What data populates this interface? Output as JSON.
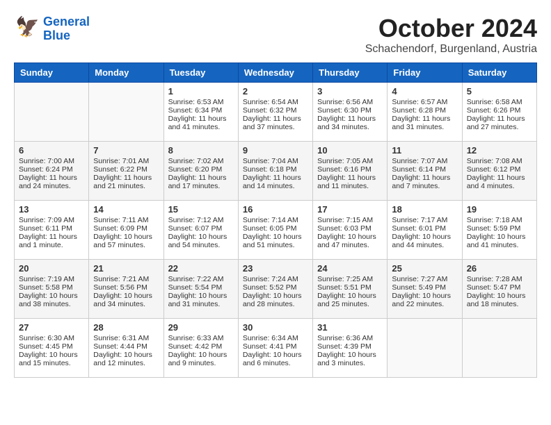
{
  "header": {
    "logo_line1": "General",
    "logo_line2": "Blue",
    "month": "October 2024",
    "location": "Schachendorf, Burgenland, Austria"
  },
  "days_of_week": [
    "Sunday",
    "Monday",
    "Tuesday",
    "Wednesday",
    "Thursday",
    "Friday",
    "Saturday"
  ],
  "weeks": [
    [
      {
        "day": "",
        "info": ""
      },
      {
        "day": "",
        "info": ""
      },
      {
        "day": "1",
        "info": "Sunrise: 6:53 AM\nSunset: 6:34 PM\nDaylight: 11 hours\nand 41 minutes."
      },
      {
        "day": "2",
        "info": "Sunrise: 6:54 AM\nSunset: 6:32 PM\nDaylight: 11 hours\nand 37 minutes."
      },
      {
        "day": "3",
        "info": "Sunrise: 6:56 AM\nSunset: 6:30 PM\nDaylight: 11 hours\nand 34 minutes."
      },
      {
        "day": "4",
        "info": "Sunrise: 6:57 AM\nSunset: 6:28 PM\nDaylight: 11 hours\nand 31 minutes."
      },
      {
        "day": "5",
        "info": "Sunrise: 6:58 AM\nSunset: 6:26 PM\nDaylight: 11 hours\nand 27 minutes."
      }
    ],
    [
      {
        "day": "6",
        "info": "Sunrise: 7:00 AM\nSunset: 6:24 PM\nDaylight: 11 hours\nand 24 minutes."
      },
      {
        "day": "7",
        "info": "Sunrise: 7:01 AM\nSunset: 6:22 PM\nDaylight: 11 hours\nand 21 minutes."
      },
      {
        "day": "8",
        "info": "Sunrise: 7:02 AM\nSunset: 6:20 PM\nDaylight: 11 hours\nand 17 minutes."
      },
      {
        "day": "9",
        "info": "Sunrise: 7:04 AM\nSunset: 6:18 PM\nDaylight: 11 hours\nand 14 minutes."
      },
      {
        "day": "10",
        "info": "Sunrise: 7:05 AM\nSunset: 6:16 PM\nDaylight: 11 hours\nand 11 minutes."
      },
      {
        "day": "11",
        "info": "Sunrise: 7:07 AM\nSunset: 6:14 PM\nDaylight: 11 hours\nand 7 minutes."
      },
      {
        "day": "12",
        "info": "Sunrise: 7:08 AM\nSunset: 6:12 PM\nDaylight: 11 hours\nand 4 minutes."
      }
    ],
    [
      {
        "day": "13",
        "info": "Sunrise: 7:09 AM\nSunset: 6:11 PM\nDaylight: 11 hours\nand 1 minute."
      },
      {
        "day": "14",
        "info": "Sunrise: 7:11 AM\nSunset: 6:09 PM\nDaylight: 10 hours\nand 57 minutes."
      },
      {
        "day": "15",
        "info": "Sunrise: 7:12 AM\nSunset: 6:07 PM\nDaylight: 10 hours\nand 54 minutes."
      },
      {
        "day": "16",
        "info": "Sunrise: 7:14 AM\nSunset: 6:05 PM\nDaylight: 10 hours\nand 51 minutes."
      },
      {
        "day": "17",
        "info": "Sunrise: 7:15 AM\nSunset: 6:03 PM\nDaylight: 10 hours\nand 47 minutes."
      },
      {
        "day": "18",
        "info": "Sunrise: 7:17 AM\nSunset: 6:01 PM\nDaylight: 10 hours\nand 44 minutes."
      },
      {
        "day": "19",
        "info": "Sunrise: 7:18 AM\nSunset: 5:59 PM\nDaylight: 10 hours\nand 41 minutes."
      }
    ],
    [
      {
        "day": "20",
        "info": "Sunrise: 7:19 AM\nSunset: 5:58 PM\nDaylight: 10 hours\nand 38 minutes."
      },
      {
        "day": "21",
        "info": "Sunrise: 7:21 AM\nSunset: 5:56 PM\nDaylight: 10 hours\nand 34 minutes."
      },
      {
        "day": "22",
        "info": "Sunrise: 7:22 AM\nSunset: 5:54 PM\nDaylight: 10 hours\nand 31 minutes."
      },
      {
        "day": "23",
        "info": "Sunrise: 7:24 AM\nSunset: 5:52 PM\nDaylight: 10 hours\nand 28 minutes."
      },
      {
        "day": "24",
        "info": "Sunrise: 7:25 AM\nSunset: 5:51 PM\nDaylight: 10 hours\nand 25 minutes."
      },
      {
        "day": "25",
        "info": "Sunrise: 7:27 AM\nSunset: 5:49 PM\nDaylight: 10 hours\nand 22 minutes."
      },
      {
        "day": "26",
        "info": "Sunrise: 7:28 AM\nSunset: 5:47 PM\nDaylight: 10 hours\nand 18 minutes."
      }
    ],
    [
      {
        "day": "27",
        "info": "Sunrise: 6:30 AM\nSunset: 4:45 PM\nDaylight: 10 hours\nand 15 minutes."
      },
      {
        "day": "28",
        "info": "Sunrise: 6:31 AM\nSunset: 4:44 PM\nDaylight: 10 hours\nand 12 minutes."
      },
      {
        "day": "29",
        "info": "Sunrise: 6:33 AM\nSunset: 4:42 PM\nDaylight: 10 hours\nand 9 minutes."
      },
      {
        "day": "30",
        "info": "Sunrise: 6:34 AM\nSunset: 4:41 PM\nDaylight: 10 hours\nand 6 minutes."
      },
      {
        "day": "31",
        "info": "Sunrise: 6:36 AM\nSunset: 4:39 PM\nDaylight: 10 hours\nand 3 minutes."
      },
      {
        "day": "",
        "info": ""
      },
      {
        "day": "",
        "info": ""
      }
    ]
  ]
}
